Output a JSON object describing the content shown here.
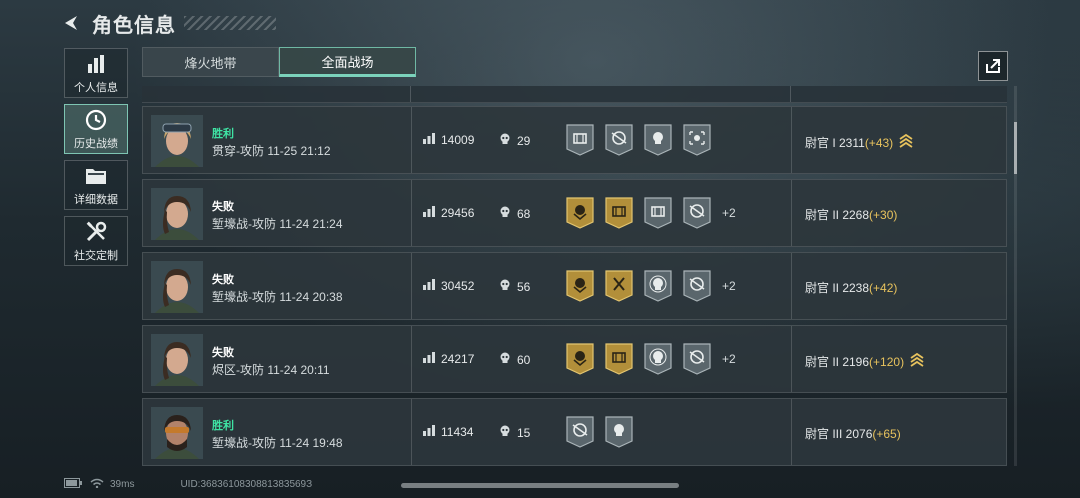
{
  "header": {
    "title": "角色信息"
  },
  "sidebar": {
    "items": [
      {
        "label": "个人信息"
      },
      {
        "label": "历史战绩"
      },
      {
        "label": "详细数据"
      },
      {
        "label": "社交定制"
      }
    ]
  },
  "tabs": [
    {
      "label": "烽火地带"
    },
    {
      "label": "全面战场"
    }
  ],
  "matches": [
    {
      "result": "胜利",
      "mode": "贯穿-攻防 11-25 21:12",
      "score": "14009",
      "kills": "29",
      "badges": [
        "crate",
        "drone",
        "skull-helmet",
        "target"
      ],
      "extra": "",
      "rank": "尉官 I  2311",
      "delta": "(+43)",
      "promoted": true
    },
    {
      "result": "失败",
      "mode": "堑壕战-攻防 11-24 21:24",
      "score": "29456",
      "kills": "68",
      "badges": [
        "medal-gold",
        "crate-gold",
        "crate",
        "drone"
      ],
      "extra": "+2",
      "rank": "尉官 II  2268",
      "delta": "(+30)",
      "promoted": false
    },
    {
      "result": "失败",
      "mode": "堑壕战-攻防 11-24 20:38",
      "score": "30452",
      "kills": "56",
      "badges": [
        "medal-gold",
        "axes-gold",
        "skull",
        "drone"
      ],
      "extra": "+2",
      "rank": "尉官 II  2238",
      "delta": "(+42)",
      "promoted": false
    },
    {
      "result": "失败",
      "mode": "烬区-攻防 11-24 20:11",
      "score": "24217",
      "kills": "60",
      "badges": [
        "medal-gold",
        "crate-gold",
        "skull",
        "drone"
      ],
      "extra": "+2",
      "rank": "尉官 II  2196",
      "delta": "(+120)",
      "promoted": true
    },
    {
      "result": "胜利",
      "mode": "堑壕战-攻防 11-24 19:48",
      "score": "11434",
      "kills": "15",
      "badges": [
        "drone",
        "skull-helmet"
      ],
      "extra": "",
      "rank": "尉官 III  2076",
      "delta": "(+65)",
      "promoted": false
    }
  ],
  "footer": {
    "ping": "39ms",
    "uid": "UID:3683610830881383569З"
  },
  "colors": {
    "win": "#3fe3a4",
    "delta": "#e7c25d",
    "accent": "#7bd2bb"
  }
}
